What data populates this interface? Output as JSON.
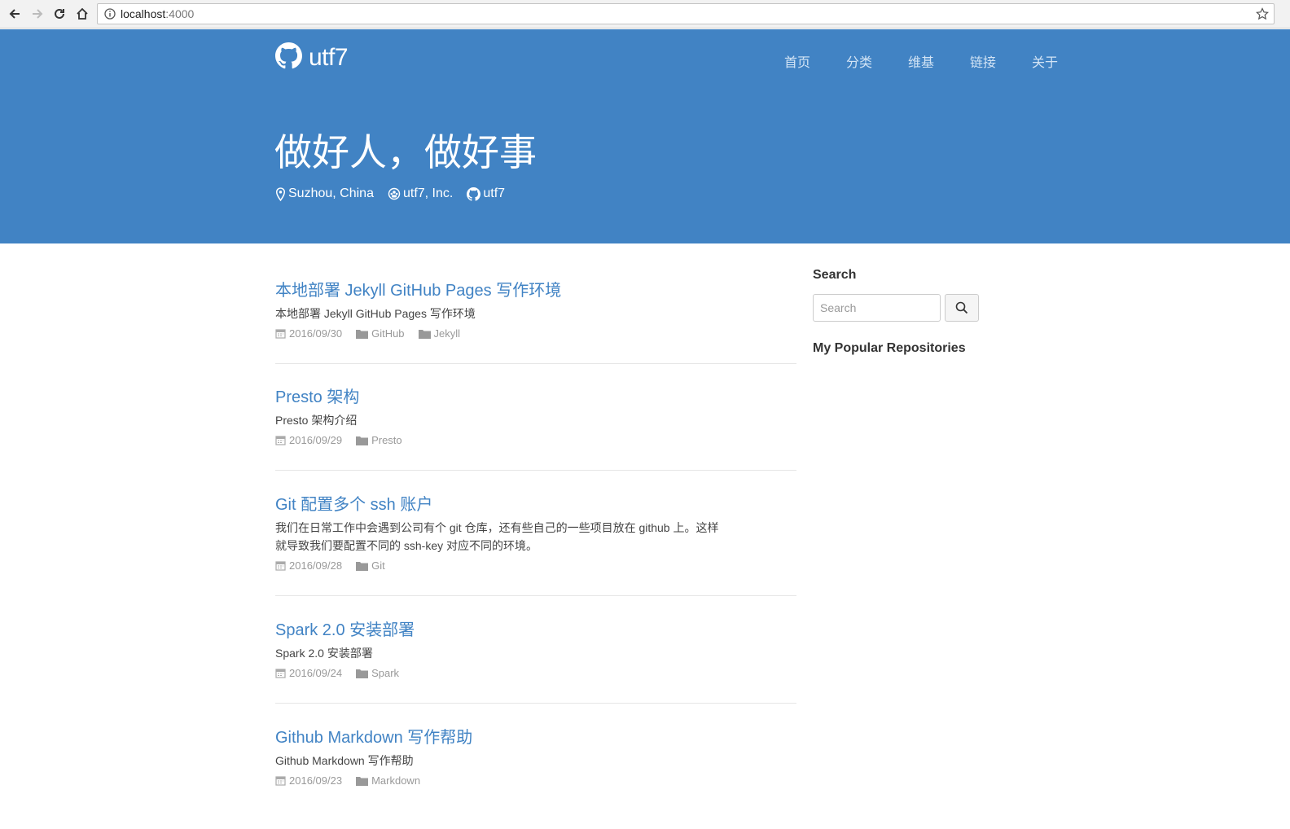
{
  "browser": {
    "url_host": "localhost",
    "url_port": ":4000",
    "icons": [
      "back-arrow-icon",
      "forward-arrow-icon",
      "reload-icon",
      "home-icon",
      "info-icon",
      "star-icon"
    ]
  },
  "header": {
    "brand": "utf7",
    "nav": [
      "首页",
      "分类",
      "维基",
      "链接",
      "关于"
    ],
    "tagline": "做好人，做好事",
    "location": "Suzhou, China",
    "company": "utf7, Inc.",
    "github_user": "utf7",
    "colors": {
      "header_bg": "#4183c4",
      "link": "#4183c4"
    }
  },
  "posts": [
    {
      "title": "本地部署 Jekyll GitHub Pages 写作环境",
      "excerpt": "本地部署 Jekyll GitHub Pages 写作环境",
      "date": "2016/09/30",
      "categories": [
        "GitHub",
        "Jekyll"
      ]
    },
    {
      "title": "Presto 架构",
      "excerpt": "Presto 架构介绍",
      "date": "2016/09/29",
      "categories": [
        "Presto"
      ]
    },
    {
      "title": "Git 配置多个 ssh 账户",
      "excerpt": "我们在日常工作中会遇到公司有个 git 仓库，还有些自己的一些项目放在 github 上。这样就导致我们要配置不同的 ssh-key 对应不同的环境。",
      "date": "2016/09/28",
      "categories": [
        "Git"
      ]
    },
    {
      "title": "Spark 2.0 安装部署",
      "excerpt": "Spark 2.0 安装部署",
      "date": "2016/09/24",
      "categories": [
        "Spark"
      ]
    },
    {
      "title": "Github Markdown 写作帮助",
      "excerpt": "Github Markdown 写作帮助",
      "date": "2016/09/23",
      "categories": [
        "Markdown"
      ]
    }
  ],
  "sidebar": {
    "search_title": "Search",
    "search_placeholder": "Search",
    "repos_title": "My Popular Repositories"
  }
}
